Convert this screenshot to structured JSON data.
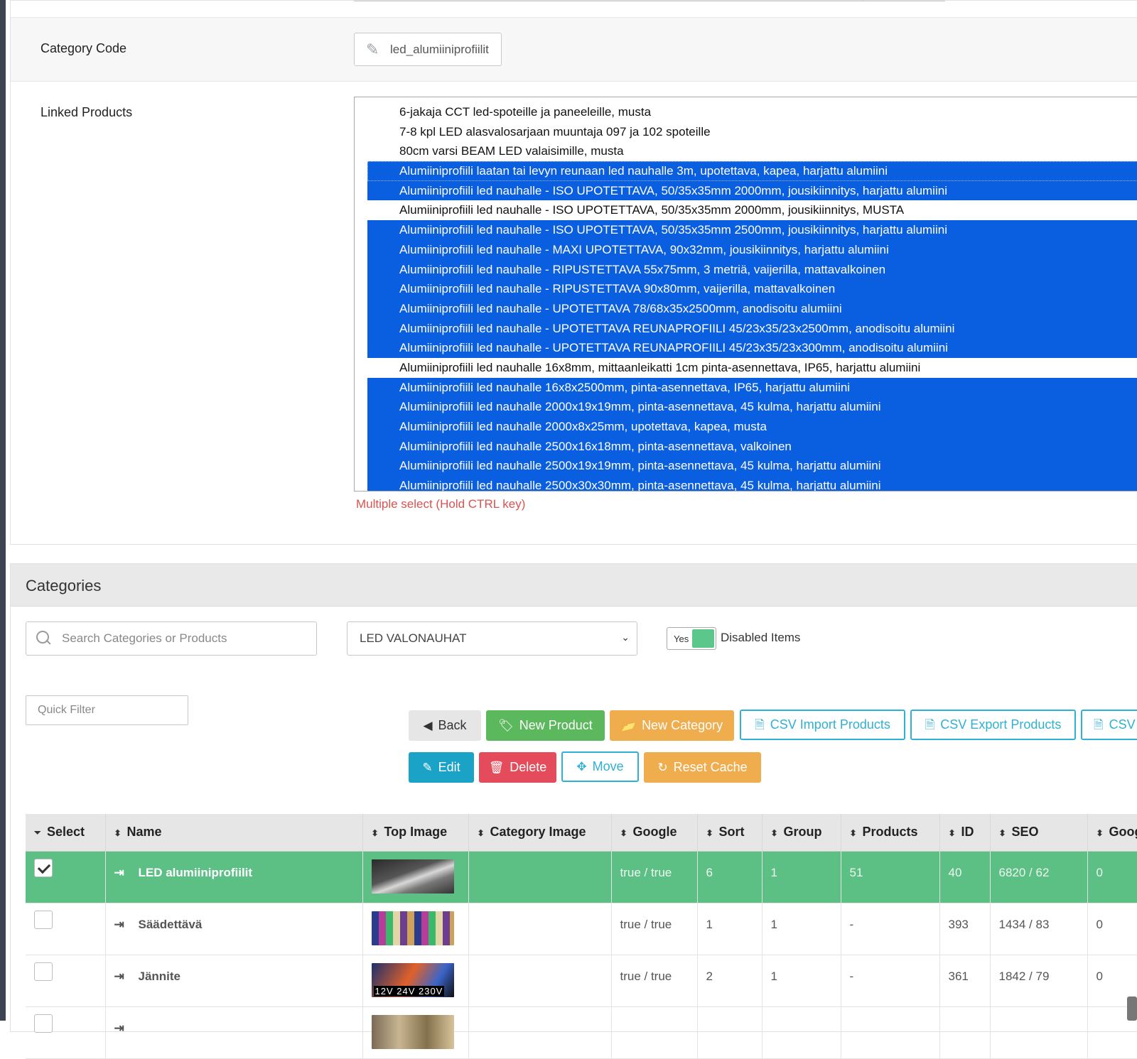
{
  "form": {
    "category_code_label": "Category Code",
    "category_code_value": "led_alumiiniprofiilit",
    "linked_products_label": "Linked Products",
    "linked_products_hint": "Multiple select (Hold CTRL key)",
    "linked_products": [
      {
        "label": "6-jakaja CCT led-spoteille ja paneeleille, musta",
        "selected": false
      },
      {
        "label": "7-8 kpl LED alasvalosarjaan muuntaja 097 ja 102 spoteille",
        "selected": false
      },
      {
        "label": "80cm varsi BEAM LED valaisimille, musta",
        "selected": false
      },
      {
        "label": "Alumiiniprofiili laatan tai levyn reunaan led nauhalle 3m, upotettava, kapea, harjattu alumiini",
        "selected": true
      },
      {
        "label": "Alumiiniprofiili led nauhalle - ISO UPOTETTAVA, 50/35x35mm 2000mm, jousikiinnitys, harjattu alumiini",
        "selected": true
      },
      {
        "label": "Alumiiniprofiili led nauhalle - ISO UPOTETTAVA, 50/35x35mm 2000mm, jousikiinnitys, MUSTA",
        "selected": false
      },
      {
        "label": "Alumiiniprofiili led nauhalle - ISO UPOTETTAVA, 50/35x35mm 2500mm, jousikiinnitys, harjattu alumiini",
        "selected": true
      },
      {
        "label": "Alumiiniprofiili led nauhalle - MAXI UPOTETTAVA, 90x32mm, jousikiinnitys, harjattu alumiini",
        "selected": true
      },
      {
        "label": "Alumiiniprofiili led nauhalle - RIPUSTETTAVA 55x75mm, 3 metriä, vaijerilla, mattavalkoinen",
        "selected": true
      },
      {
        "label": "Alumiiniprofiili led nauhalle - RIPUSTETTAVA 90x80mm, vaijerilla, mattavalkoinen",
        "selected": true
      },
      {
        "label": "Alumiiniprofiili led nauhalle - UPOTETTAVA 78/68x35x2500mm, anodisoitu alumiini",
        "selected": true
      },
      {
        "label": "Alumiiniprofiili led nauhalle - UPOTETTAVA REUNAPROFIILI 45/23x35/23x2500mm, anodisoitu alumiini",
        "selected": true
      },
      {
        "label": "Alumiiniprofiili led nauhalle - UPOTETTAVA REUNAPROFIILI 45/23x35/23x300mm, anodisoitu alumiini",
        "selected": true
      },
      {
        "label": "Alumiiniprofiili led nauhalle 16x8mm, mittaanleikatti 1cm pinta-asennettava, IP65, harjattu alumiini",
        "selected": false
      },
      {
        "label": "Alumiiniprofiili led nauhalle 16x8x2500mm, pinta-asennettava, IP65, harjattu alumiini",
        "selected": true
      },
      {
        "label": "Alumiiniprofiili led nauhalle 2000x19x19mm, pinta-asennettava, 45 kulma, harjattu alumiini",
        "selected": true
      },
      {
        "label": "Alumiiniprofiili led nauhalle 2000x8x25mm, upotettava, kapea, musta",
        "selected": true
      },
      {
        "label": "Alumiiniprofiili led nauhalle 2500x16x18mm, pinta-asennettava, valkoinen",
        "selected": true
      },
      {
        "label": "Alumiiniprofiili led nauhalle 2500x19x19mm, pinta-asennettava, 45 kulma, harjattu alumiini",
        "selected": true
      },
      {
        "label": "Alumiiniprofiili led nauhalle 2500x30x30mm, pinta-asennettava, 45 kulma, harjattu alumiini",
        "selected": true
      }
    ]
  },
  "categories": {
    "title": "Categories",
    "search_placeholder": "Search Categories or Products",
    "category_select_value": "LED VALONAUHAT",
    "disabled_toggle_state": "Yes",
    "disabled_toggle_label": "Disabled Items",
    "quick_filter_placeholder": "Quick Filter",
    "buttons": {
      "back": "Back",
      "new_product": "New Product",
      "new_category": "New Category",
      "csv_import": "CSV Import Products",
      "csv_export": "CSV Export Products",
      "csv_third": "CSV",
      "edit": "Edit",
      "delete": "Delete",
      "move": "Move",
      "reset_cache": "Reset Cache"
    },
    "columns": [
      "Select",
      "Name",
      "Top Image",
      "Category Image",
      "Google",
      "Sort",
      "Group",
      "Products",
      "ID",
      "SEO",
      "Goog"
    ],
    "rows": [
      {
        "checked": true,
        "name": "LED alumiiniprofiilit",
        "top_image": "aluminium-profiles-thumbnail",
        "category_image": "",
        "google": "true / true",
        "sort": "6",
        "group": "1",
        "products": "51",
        "id": "40",
        "seo": "6820 / 62",
        "goog": "0",
        "active": true
      },
      {
        "checked": false,
        "name": "Säädettävä",
        "top_image": "color-led-strips-thumbnail",
        "category_image": "",
        "google": "true / true",
        "sort": "1",
        "group": "1",
        "products": "-",
        "id": "393",
        "seo": "1434 / 83",
        "goog": "0",
        "active": false
      },
      {
        "checked": false,
        "name": "Jännite",
        "top_image": "voltage-thumbnail",
        "top_image_text": "12V 24V 230V",
        "category_image": "",
        "google": "true / true",
        "sort": "2",
        "group": "1",
        "products": "-",
        "id": "361",
        "seo": "1842 / 79",
        "goog": "0",
        "active": false
      },
      {
        "checked": false,
        "name": "",
        "top_image": "partial-thumbnail",
        "category_image": "",
        "google": "",
        "sort": "",
        "group": "",
        "products": "",
        "id": "",
        "seo": "",
        "goog": "",
        "active": false
      }
    ]
  },
  "colors": {
    "selected_option": "#0a5fe0",
    "active_row": "#5cc084",
    "success": "#5cb85c",
    "warning": "#f0ad4e",
    "info": "#31b0d5",
    "danger": "#e44c5b",
    "hint": "#d9534f"
  }
}
